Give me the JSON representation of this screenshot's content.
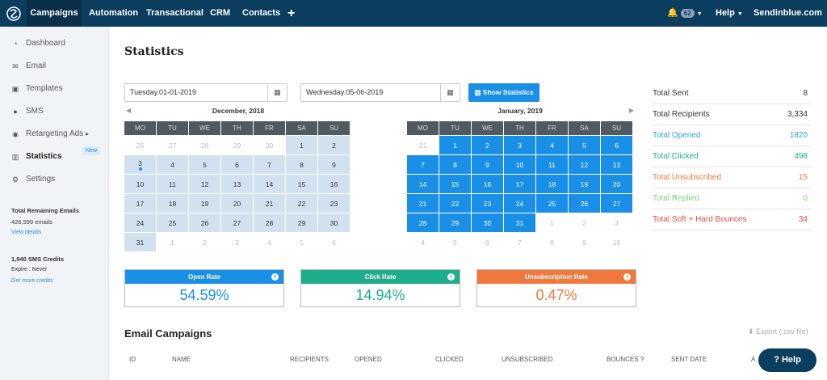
{
  "topbar": {
    "nav": [
      "Campaigns",
      "Automation",
      "Transactional",
      "CRM",
      "Contacts"
    ],
    "plus": "+",
    "notif_count": "62",
    "help": "Help",
    "account": "Sendinblue.com"
  },
  "sidebar": {
    "items": [
      {
        "label": "Dashboard",
        "icon": "dashboard-icon",
        "glyph": "◔"
      },
      {
        "label": "Email",
        "icon": "envelope-icon",
        "glyph": "✉"
      },
      {
        "label": "Templates",
        "icon": "templates-icon",
        "glyph": "▣"
      },
      {
        "label": "SMS",
        "icon": "chat-icon",
        "glyph": "●"
      },
      {
        "label": "Retargeting Ads",
        "icon": "target-icon",
        "glyph": "◉"
      },
      {
        "label": "Statistics",
        "icon": "bar-chart-icon",
        "glyph": "▥"
      },
      {
        "label": "Settings",
        "icon": "gear-icon",
        "glyph": "⚙"
      }
    ],
    "new_badge": "New",
    "emails_title": "Total Remaining Emails",
    "emails_count": "426,599 emails",
    "emails_link": "View details",
    "sms_title": "1,940 SMS Credits",
    "sms_expire": "Expire : Never",
    "sms_link": "Get more credits"
  },
  "page": {
    "title": "Statistics",
    "start_date": "Tuesday.01-01-2019",
    "end_date": "Wednesday.05-06-2019",
    "show_btn": "Show Statistics",
    "cal1_title": "December, 2018",
    "cal2_title": "January, 2019",
    "weekdays": [
      "MO",
      "TU",
      "WE",
      "TH",
      "FR",
      "SA",
      "SU"
    ]
  },
  "cal1": [
    [
      [
        "26",
        "o"
      ],
      [
        "27",
        "o"
      ],
      [
        "28",
        "o"
      ],
      [
        "29",
        "o"
      ],
      [
        "30",
        "o"
      ],
      [
        "1",
        "i"
      ],
      [
        "2",
        "i"
      ]
    ],
    [
      [
        "3",
        "d"
      ],
      [
        "4",
        "i"
      ],
      [
        "5",
        "i"
      ],
      [
        "6",
        "i"
      ],
      [
        "7",
        "i"
      ],
      [
        "8",
        "i"
      ],
      [
        "9",
        "i"
      ]
    ],
    [
      [
        "10",
        "i"
      ],
      [
        "11",
        "i"
      ],
      [
        "12",
        "i"
      ],
      [
        "13",
        "i"
      ],
      [
        "14",
        "i"
      ],
      [
        "15",
        "i"
      ],
      [
        "16",
        "i"
      ]
    ],
    [
      [
        "17",
        "i"
      ],
      [
        "18",
        "i"
      ],
      [
        "19",
        "i"
      ],
      [
        "20",
        "i"
      ],
      [
        "21",
        "i"
      ],
      [
        "22",
        "i"
      ],
      [
        "23",
        "i"
      ]
    ],
    [
      [
        "24",
        "i"
      ],
      [
        "25",
        "i"
      ],
      [
        "26",
        "i"
      ],
      [
        "27",
        "i"
      ],
      [
        "28",
        "i"
      ],
      [
        "29",
        "i"
      ],
      [
        "30",
        "i"
      ]
    ],
    [
      [
        "31",
        "i"
      ],
      [
        "1",
        "o"
      ],
      [
        "2",
        "o"
      ],
      [
        "3",
        "o"
      ],
      [
        "4",
        "o"
      ],
      [
        "5",
        "o"
      ],
      [
        "6",
        "o"
      ]
    ]
  ],
  "cal2": [
    [
      [
        "31",
        "o"
      ],
      [
        "1",
        "s"
      ],
      [
        "2",
        "s"
      ],
      [
        "3",
        "s"
      ],
      [
        "4",
        "s"
      ],
      [
        "5",
        "s"
      ],
      [
        "6",
        "s"
      ]
    ],
    [
      [
        "7",
        "s"
      ],
      [
        "8",
        "s"
      ],
      [
        "9",
        "s"
      ],
      [
        "10",
        "s"
      ],
      [
        "11",
        "s"
      ],
      [
        "12",
        "s"
      ],
      [
        "13",
        "s"
      ]
    ],
    [
      [
        "14",
        "s"
      ],
      [
        "15",
        "s"
      ],
      [
        "16",
        "s"
      ],
      [
        "17",
        "s"
      ],
      [
        "18",
        "s"
      ],
      [
        "19",
        "s"
      ],
      [
        "20",
        "s"
      ]
    ],
    [
      [
        "21",
        "s"
      ],
      [
        "22",
        "s"
      ],
      [
        "23",
        "s"
      ],
      [
        "24",
        "s"
      ],
      [
        "25",
        "s"
      ],
      [
        "26",
        "s"
      ],
      [
        "27",
        "s"
      ]
    ],
    [
      [
        "28",
        "s"
      ],
      [
        "29",
        "s"
      ],
      [
        "30",
        "s"
      ],
      [
        "31",
        "s"
      ],
      [
        "1",
        "o"
      ],
      [
        "2",
        "o"
      ],
      [
        "3",
        "o"
      ]
    ],
    [
      [
        "4",
        "o"
      ],
      [
        "5",
        "o"
      ],
      [
        "6",
        "o"
      ],
      [
        "7",
        "o"
      ],
      [
        "8",
        "o"
      ],
      [
        "9",
        "o"
      ],
      [
        "10",
        "o"
      ]
    ]
  ],
  "stats": [
    {
      "label": "Total Sent",
      "value": "8",
      "color": "#333333"
    },
    {
      "label": "Total Recipients",
      "value": "3,334",
      "color": "#333333"
    },
    {
      "label": "Total Opened",
      "value": "1820",
      "color": "#2ea4d8"
    },
    {
      "label": "Total Clicked",
      "value": "498",
      "color": "#1fae8c"
    },
    {
      "label": "Total Unsubscribed",
      "value": "15",
      "color": "#f0783c"
    },
    {
      "label": "Total Replied",
      "value": "0",
      "color": "#7ed07e"
    },
    {
      "label": "Total Soft + Hard Bounces",
      "value": "34",
      "color": "#e14b4b"
    }
  ],
  "rates": [
    {
      "label": "Open Rate",
      "value": "54.59%",
      "color": "#1a8fe8"
    },
    {
      "label": "Click Rate",
      "value": "14.94%",
      "color": "#1fae8c"
    },
    {
      "label": "Unsubscription Rate",
      "value": "0.47%",
      "color": "#f0783c"
    }
  ],
  "campaigns": {
    "title": "Email Campaigns",
    "export": "Export (.csv file)",
    "columns": [
      "ID",
      "NAME",
      "RECIPIENTS",
      "OPENED",
      "CLICKED",
      "UNSUBSCRIBED",
      "BOUNCES",
      "SENT DATE",
      "A"
    ]
  },
  "help_button": "Help"
}
